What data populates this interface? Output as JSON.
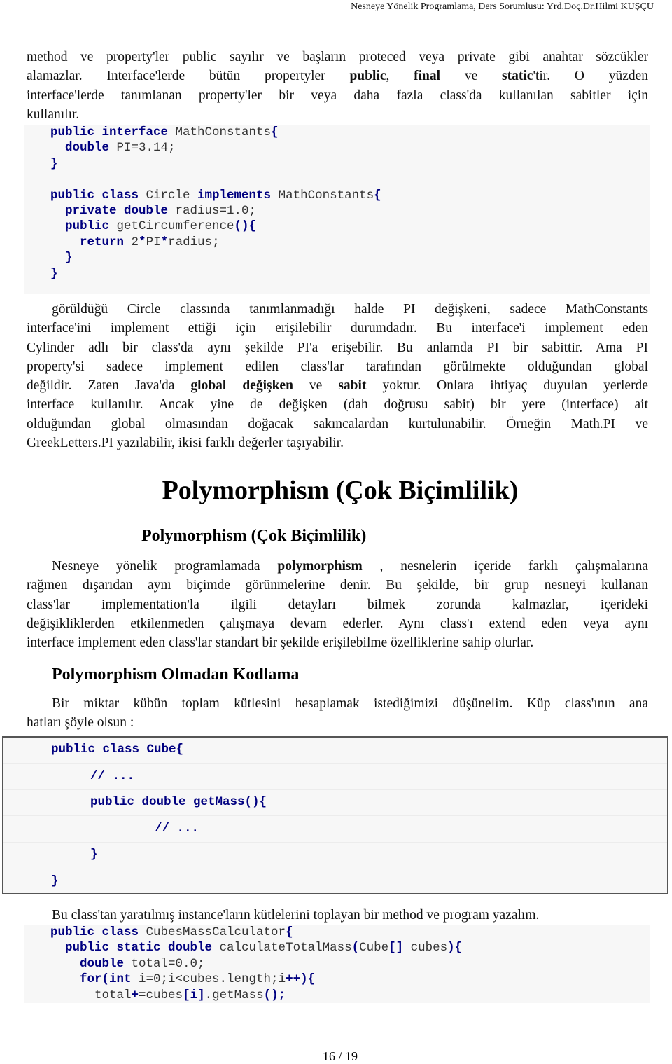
{
  "header": {
    "text": "Nesneye Yönelik Programlama,  Ders Sorumlusu: Yrd.Doç.Dr.Hilmi KUŞÇU"
  },
  "intro": {
    "line1": "method ve property'ler public sayılır ve başların proteced veya private gibi anahtar sözcükler",
    "line2_a": "alamazlar. Interface'lerde bütün propertyler ",
    "line2_b1": "public",
    "line2_c": ", ",
    "line2_b2": "final",
    "line2_d": " ve ",
    "line2_b3": "static",
    "line2_e": "'tir. O yüzden",
    "line3": "interface'lerde tanımlanan property'ler bir veya daha fazla class'da kullanılan sabitler için",
    "line4": "kullanılır."
  },
  "code1": {
    "lines": [
      [
        {
          "t": "public interface ",
          "k": 1
        },
        {
          "t": "MathConstants",
          "k": 0
        },
        {
          "t": "{",
          "k": 1
        }
      ],
      [
        {
          "t": "  double ",
          "k": 1
        },
        {
          "t": "PI=3.14;",
          "k": 0
        }
      ],
      [
        {
          "t": "}",
          "k": 1
        }
      ],
      [],
      [
        {
          "t": "public class ",
          "k": 1
        },
        {
          "t": "Circle ",
          "k": 0
        },
        {
          "t": "implements ",
          "k": 1
        },
        {
          "t": "MathConstants",
          "k": 0
        },
        {
          "t": "{",
          "k": 1
        }
      ],
      [
        {
          "t": "  private double ",
          "k": 1
        },
        {
          "t": "radius=1.0;",
          "k": 0
        }
      ],
      [
        {
          "t": "  public ",
          "k": 1
        },
        {
          "t": "getCircumference",
          "k": 0
        },
        {
          "t": "(){",
          "k": 1
        }
      ],
      [
        {
          "t": "    return ",
          "k": 1
        },
        {
          "t": "2",
          "k": 0
        },
        {
          "t": "*",
          "k": 1
        },
        {
          "t": "PI",
          "k": 0
        },
        {
          "t": "*",
          "k": 1
        },
        {
          "t": "radius;",
          "k": 0
        }
      ],
      [
        {
          "t": "  }",
          "k": 1
        }
      ],
      [
        {
          "t": "}",
          "k": 1
        }
      ]
    ]
  },
  "para2": {
    "lines": [
      "görüldüğü Circle classında tanımlanmadığı halde PI değişkeni, sadece MathConstants",
      "interface'ini implement ettiği için erişilebilir durumdadır. Bu interface'i implement eden",
      "Cylinder adlı bir class'da aynı şekilde PI'a erişebilir. Bu anlamda PI bir sabittir. Ama PI",
      "property'si sadece implement edilen class'lar tarafından görülmekte olduğundan global"
    ],
    "line5_a": "değildir. Zaten Java'da ",
    "line5_b1": "global değişken",
    "line5_c": " ve ",
    "line5_b2": "sabit",
    "line5_d": " yoktur. Onlara ihtiyaç duyulan yerlerde",
    "line6": "interface kullanılır. Ancak yine de değişken (dah doğrusu sabit) bir yere (interface) ait",
    "line7": "olduğundan global olmasından doğacak sakıncalardan kurtulunabilir. Örneğin Math.PI ve",
    "line8": "GreekLetters.PI yazılabilir, ikisi farklı değerler taşıyabilir."
  },
  "heading1": "Polymorphism (Çok Biçimlilik)",
  "heading2": "Polymorphism (Çok Biçimlilik)",
  "para3": {
    "line1_a": "Nesneye yönelik programlamada ",
    "line1_b": "polymorphism",
    "line1_c": " , nesnelerin içeride farklı çalışmalarına",
    "line2": "rağmen dışarıdan aynı biçimde görünmelerine denir. Bu şekilde, bir grup nesneyi kullanan",
    "line3": "class'lar implementation'la ilgili detayları bilmek zorunda kalmazlar, içerideki",
    "line4": "değişikliklerden etkilenmeden çalışmaya devam ederler. Aynı class'ı extend eden veya aynı",
    "line5": "interface implement eden class'lar standart bir şekilde erişilebilme özelliklerine sahip olurlar."
  },
  "heading3": "Polymorphism Olmadan Kodlama",
  "para4": {
    "line1": "Bir miktar kübün toplam kütlesini hesaplamak istediğimizi düşünelim. Küp class'ının ana",
    "line2": "hatları şöyle olsun :"
  },
  "code2": {
    "lines": [
      "public class Cube{",
      "// ...",
      "public double getMass(){",
      "// ...",
      "}",
      "}"
    ]
  },
  "para5": "Bu class'tan yaratılmış instance'ların kütlelerini toplayan bir method ve program yazalım.",
  "code3": {
    "lines": [
      [
        {
          "t": "public class ",
          "k": 1
        },
        {
          "t": "CubesMassCalculator",
          "k": 0
        },
        {
          "t": "{",
          "k": 1
        }
      ],
      [
        {
          "t": "  public static double ",
          "k": 1
        },
        {
          "t": "calculateTotalMass",
          "k": 0
        },
        {
          "t": "(",
          "k": 1
        },
        {
          "t": "Cube",
          "k": 0
        },
        {
          "t": "[] ",
          "k": 1
        },
        {
          "t": "cubes",
          "k": 0
        },
        {
          "t": "){",
          "k": 1
        }
      ],
      [
        {
          "t": "    double ",
          "k": 1
        },
        {
          "t": "total=0.0;",
          "k": 0
        }
      ],
      [
        {
          "t": "    for(int ",
          "k": 1
        },
        {
          "t": "i=0;i<cubes.length;i",
          "k": 0
        },
        {
          "t": "++){",
          "k": 1
        }
      ],
      [
        {
          "t": "      ",
          "k": 0
        },
        {
          "t": "total",
          "k": 0
        },
        {
          "t": "+",
          "k": 1
        },
        {
          "t": "=cubes",
          "k": 0
        },
        {
          "t": "[i]",
          "k": 1
        },
        {
          "t": ".getMass",
          "k": 0
        },
        {
          "t": "();",
          "k": 1
        }
      ]
    ]
  },
  "footer": {
    "page": "16 / 19"
  },
  "colors": {
    "keyword": "#000080",
    "code_bg": "#f7f7f7",
    "code_text": "#333333"
  }
}
